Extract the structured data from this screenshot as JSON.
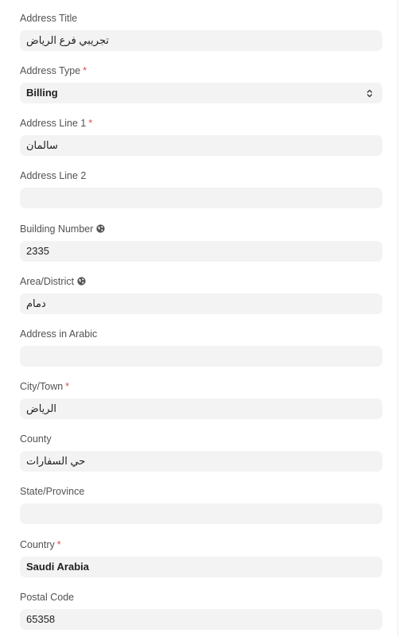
{
  "fields": {
    "address_title": {
      "label": "Address Title",
      "value": "تجريبي فرع الرياض"
    },
    "address_type": {
      "label": "Address Type",
      "required_mark": "*",
      "value": "Billing",
      "icon": "select-arrows-icon"
    },
    "address_line1": {
      "label": "Address Line 1",
      "required_mark": "*",
      "value": "سالمان"
    },
    "address_line2": {
      "label": "Address Line 2",
      "value": ""
    },
    "building_number": {
      "label": "Building Number",
      "value": "2335",
      "icon": "globe-icon"
    },
    "area_district": {
      "label": "Area/District",
      "value": "دمام",
      "icon": "globe-icon"
    },
    "address_in_arabic": {
      "label": "Address in Arabic",
      "value": ""
    },
    "city_town": {
      "label": "City/Town",
      "required_mark": "*",
      "value": "الرياض"
    },
    "county": {
      "label": "County",
      "value": "حي السفارات"
    },
    "state_province": {
      "label": "State/Province",
      "value": ""
    },
    "country": {
      "label": "Country",
      "required_mark": "*",
      "value": "Saudi Arabia"
    },
    "postal_code": {
      "label": "Postal Code",
      "value": "65358"
    }
  },
  "colors": {
    "required": "#e24c4c",
    "input_background": "#f3f3f3",
    "label_text": "#525252"
  }
}
